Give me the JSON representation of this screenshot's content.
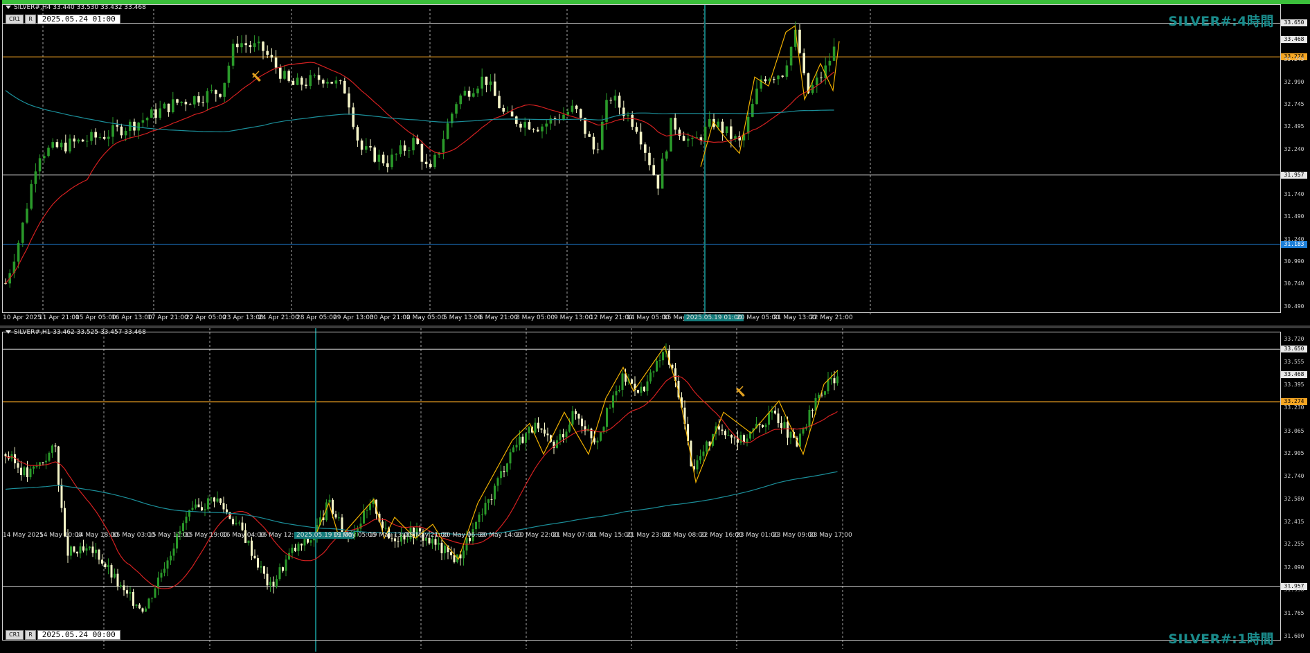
{
  "top": {
    "header": "SILVER#,H4 33.440 33.530 33.432 33.468",
    "btn1": "CR1",
    "btn2": "R",
    "date": "2025.05.24 01:00",
    "title": "SILVER#:4時間",
    "price_scale": [
      "33.650",
      "33.468",
      "33.274",
      "33.243",
      "32.990",
      "32.745",
      "32.495",
      "32.240",
      "31.957",
      "31.740",
      "31.490",
      "31.240",
      "31.183",
      "30.990",
      "30.740",
      "30.490"
    ],
    "levels": {
      "upper": "33.650",
      "current": "33.468",
      "orange": "33.274",
      "lower": "31.957",
      "blue": "31.183"
    },
    "time_labels": [
      "10 Apr 2025",
      "11 Apr 21:00",
      "15 Apr 05:00",
      "16 Apr 13:00",
      "17 Apr 21:00",
      "22 Apr 05:00",
      "23 Apr 13:00",
      "24 Apr 21:00",
      "28 Apr 05:00",
      "29 Apr 13:00",
      "30 Apr 21:00",
      "2 May 05:00",
      "5 May 13:00",
      "6 May 21:00",
      "8 May 05:00",
      "9 May 13:00",
      "12 May 21:00",
      "14 May 05:00",
      "15 May",
      "2025.05.19 01:00",
      "20 May 05:00",
      "21 May 13:00",
      "22 May 21:00"
    ]
  },
  "bottom": {
    "header": "SILVER#,H1 33.462 33.525 33.457 33.468",
    "btn1": "CR1",
    "btn2": "R",
    "date": "2025.05.24 00:00",
    "title": "SILVER#:1時間",
    "price_scale": [
      "33.720",
      "33.650",
      "33.555",
      "33.468",
      "33.395",
      "33.274",
      "33.230",
      "33.065",
      "32.905",
      "32.740",
      "32.580",
      "32.415",
      "32.255",
      "32.090",
      "31.957",
      "31.930",
      "31.765",
      "31.600"
    ],
    "levels": {
      "upper": "33.650",
      "current": "33.468",
      "orange": "33.274",
      "lower": "31.957"
    },
    "time_labels": [
      "14 May 2025",
      "14 May 10:00",
      "14 May 18:00",
      "15 May 03:00",
      "15 May 11:00",
      "15 May 19:00",
      "16 May 04:00",
      "16 May 12:00",
      "2025.05.19 01:00",
      "19 May 05:00",
      "19 May 13:00",
      "19 May 21:00",
      "20 May 06:00",
      "20 May 14:00",
      "20 May 22:00",
      "21 May 07:00",
      "21 May 15:00",
      "21 May 23:00",
      "22 May 08:00",
      "22 May 16:00",
      "23 May 01:00",
      "23 May 09:00",
      "23 May 17:00"
    ]
  },
  "colors": {
    "bull": "#2a9a2a",
    "bear": "#f5f5c8",
    "ma_fast": "#d42020",
    "ma_slow": "#1b8f9a",
    "zigzag": "#f0b000",
    "teal": "#137a7a",
    "orange": "#f5a623",
    "blue": "#1e7fd8"
  }
}
